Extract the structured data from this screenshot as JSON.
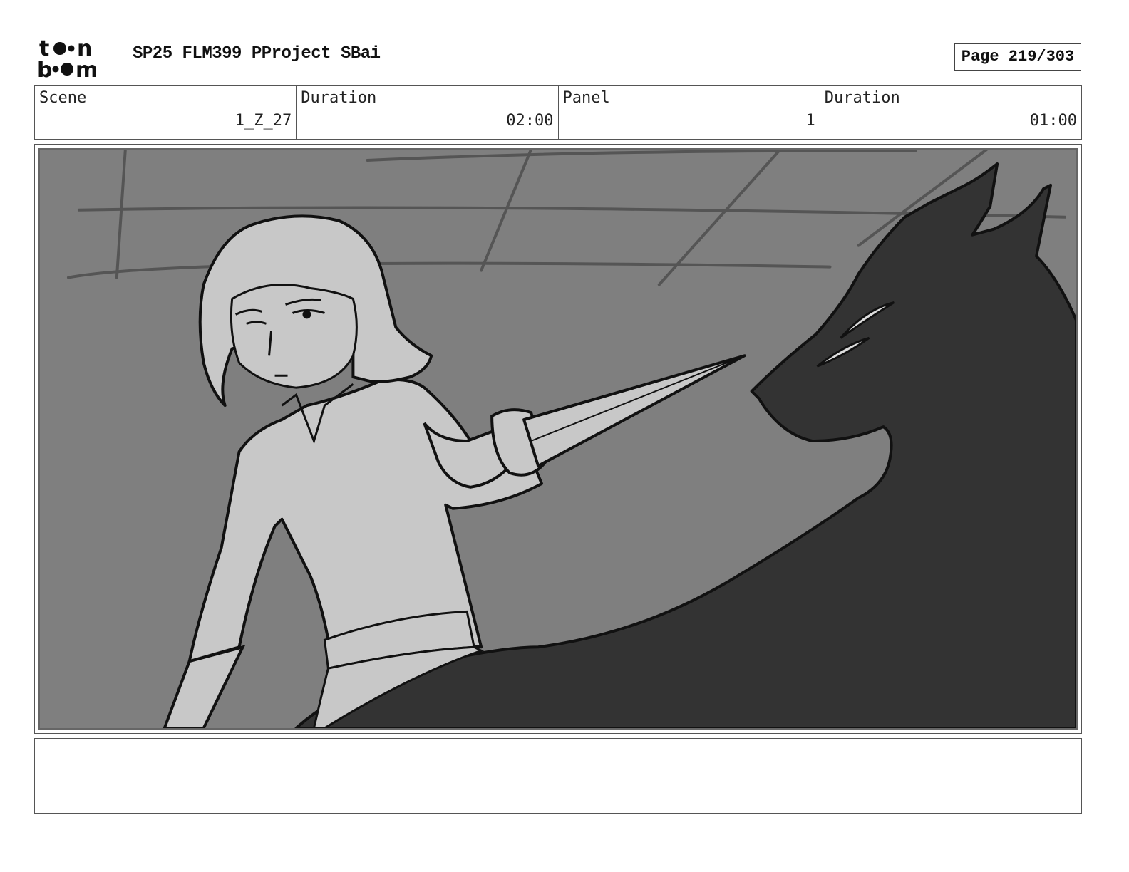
{
  "header": {
    "logo_name": "toon-boom-logo",
    "project_title": "SP25 FLM399 PProject SBai",
    "page_label": "Page 219/303"
  },
  "info": {
    "scene_label": "Scene",
    "scene_value": "1_Z_27",
    "scene_duration_label": "Duration",
    "scene_duration_value": "02:00",
    "panel_label": "Panel",
    "panel_value": "1",
    "panel_duration_label": "Duration",
    "panel_duration_value": "01:00"
  },
  "notes": {
    "text": ""
  },
  "colors": {
    "background": "#7f7f7f",
    "character": "#c8c8c8",
    "creature": "#333333",
    "lines": "#111111"
  }
}
